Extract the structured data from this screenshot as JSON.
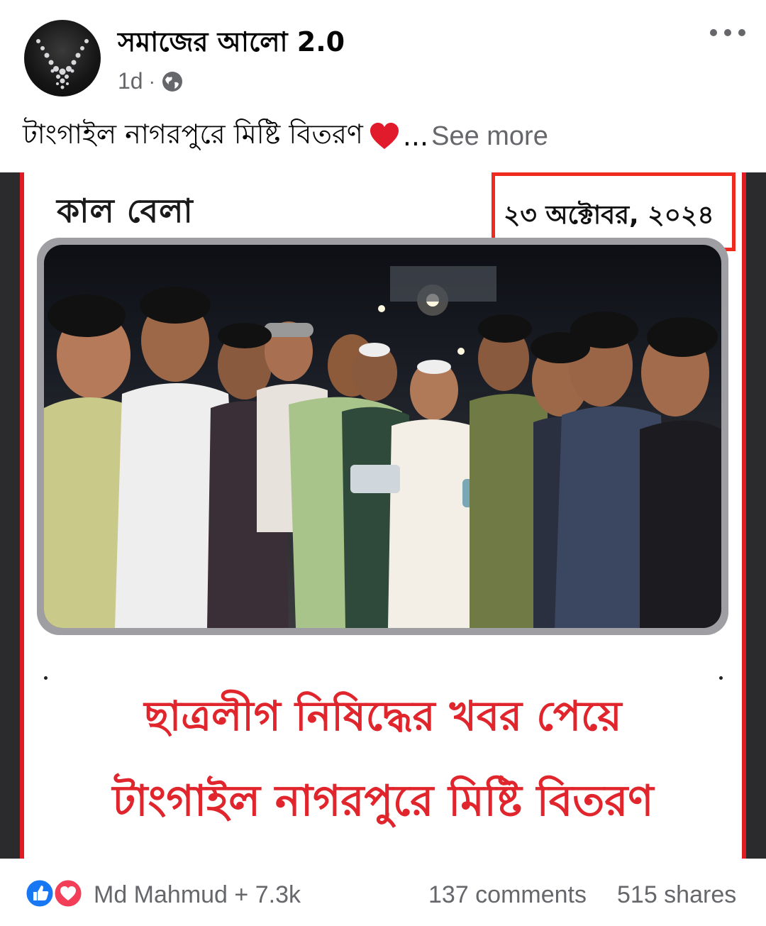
{
  "post": {
    "page_name": "সমাজের আলো 2.0",
    "time": "1d",
    "separator": "·",
    "privacy_icon": "globe-icon",
    "more_icon": "more-options-icon",
    "caption": "টাংগাইল নাগরপুরে মিষ্টি বিতরণ",
    "caption_emoji": "red-heart-icon",
    "ellipsis": "...",
    "see_more": "See more"
  },
  "image": {
    "logo": "কাল বেলা",
    "date": "২৩ অক্টোবর, ২০২৪",
    "headline_line1": "ছাত্রলীগ নিষিদ্ধের খবর পেয়ে",
    "headline_line2": "টাংগাইল নাগরপুরে মিষ্টি বিতরণ",
    "highlight_color": "#ef2b1f",
    "headline_color": "#e0262c"
  },
  "footer": {
    "reaction_icons": [
      "like-icon",
      "love-icon"
    ],
    "reactors": "Md Mahmud + 7.3k",
    "comments": "137 comments",
    "shares": "515 shares"
  }
}
